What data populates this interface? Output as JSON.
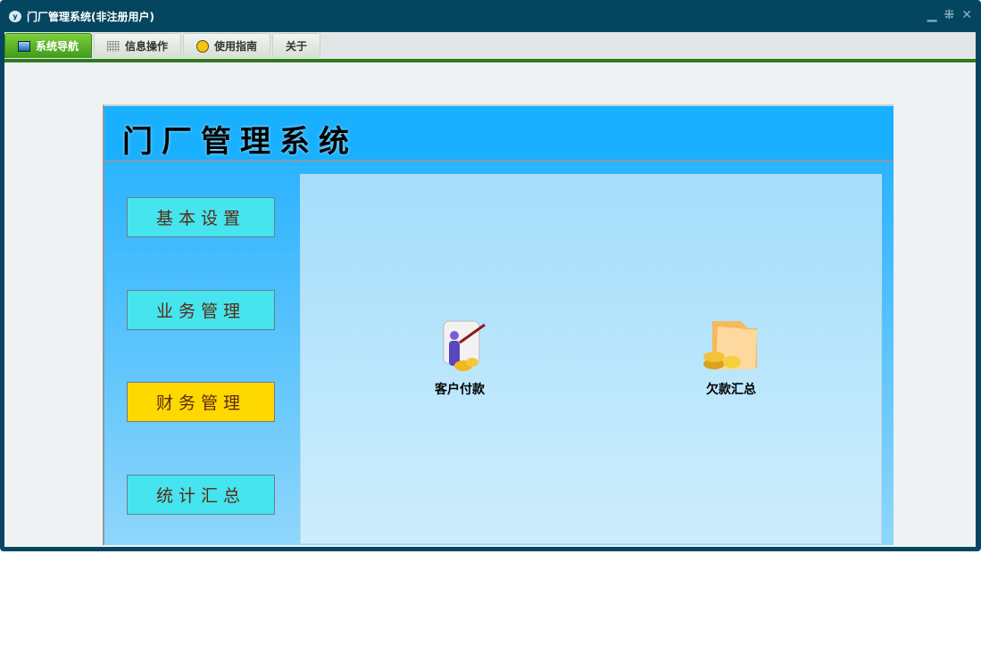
{
  "window": {
    "title": "门厂管理系统(非注册用户)",
    "controls": [
      "minimize",
      "restore",
      "close"
    ]
  },
  "tabs": [
    {
      "label": "系统导航",
      "icon": "monitor-icon"
    },
    {
      "label": "信息操作",
      "icon": "grid-icon"
    },
    {
      "label": "使用指南",
      "icon": "help-icon"
    },
    {
      "label": "关于"
    }
  ],
  "header": {
    "title": "门厂管理系统"
  },
  "nav": [
    {
      "label": "基本设置"
    },
    {
      "label": "业务管理"
    },
    {
      "label": "财务管理",
      "selected": true
    },
    {
      "label": "统计汇总"
    }
  ],
  "items": [
    {
      "label": "客户付款",
      "icon": "customer-payment-icon"
    },
    {
      "label": "欠款汇总",
      "icon": "debt-summary-icon"
    }
  ],
  "colors": {
    "frame": "#04465f",
    "tab_active": "#4ea824",
    "header": "#19b0ff",
    "nav_button": "#45e4ef",
    "nav_selected": "#ffd800"
  }
}
